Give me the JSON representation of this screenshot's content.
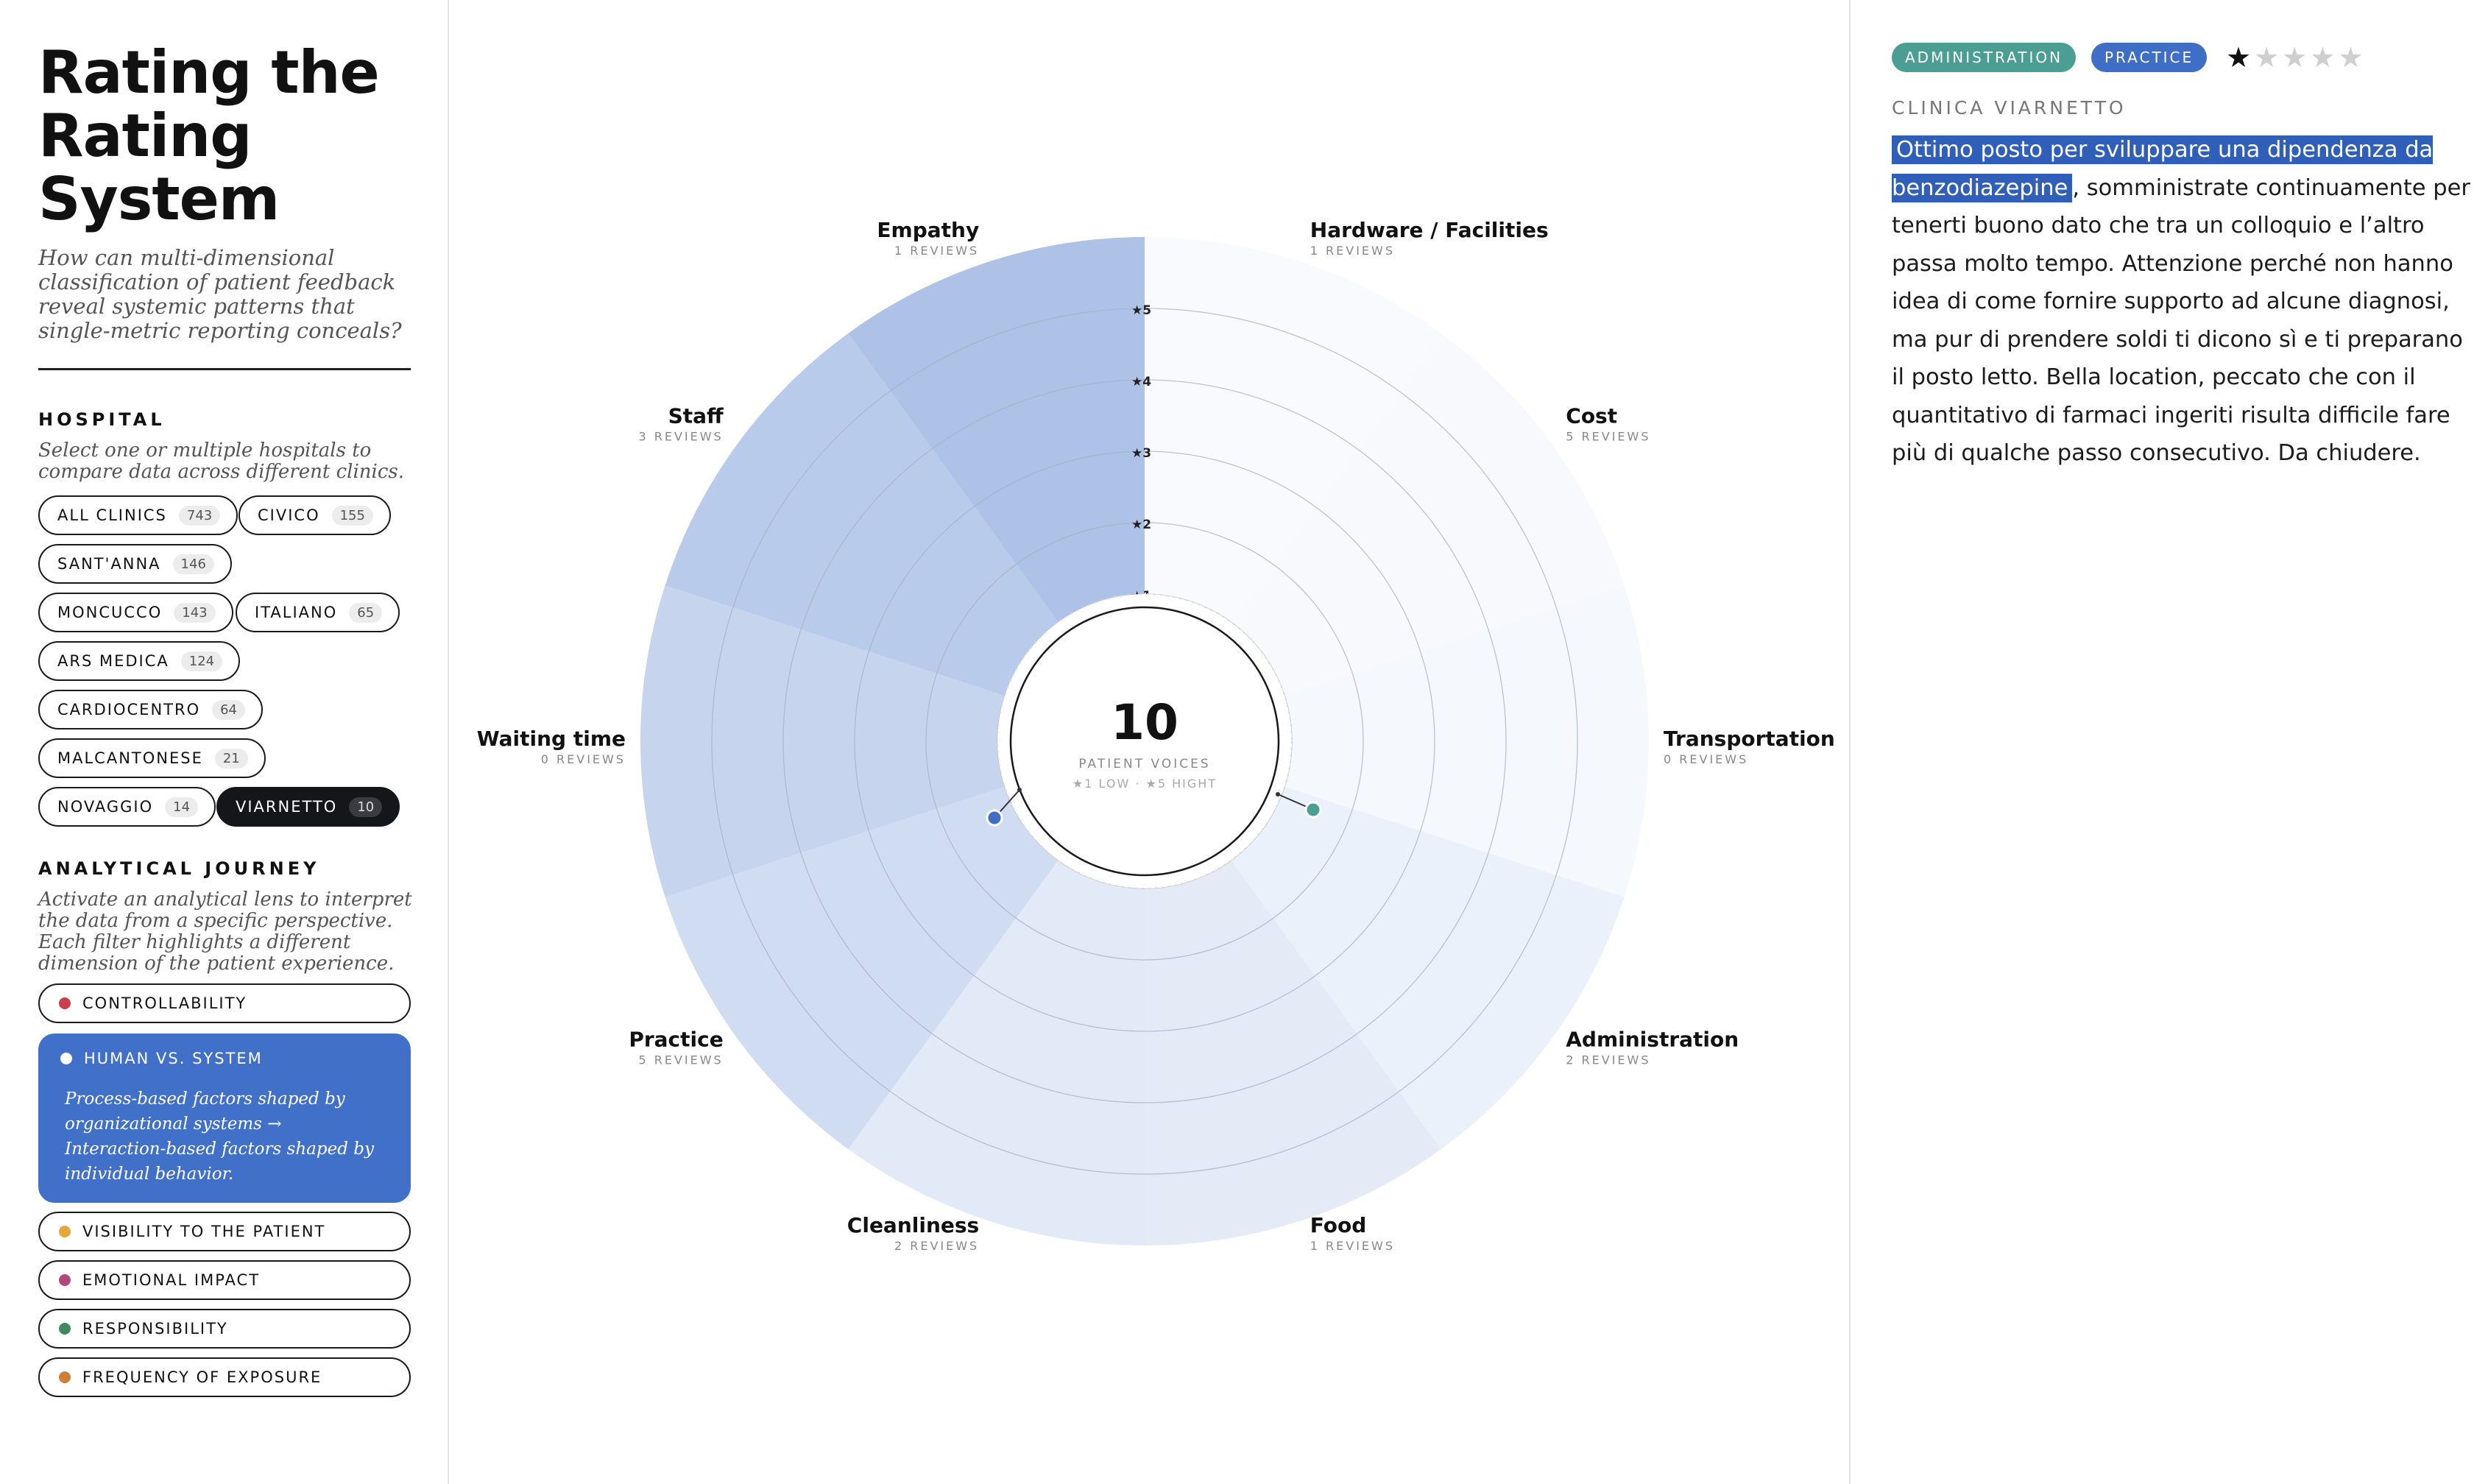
{
  "sidebar": {
    "title": "Rating the Rating System",
    "subtitle": "How can multi-dimensional classification of patient feedback reveal systemic patterns that single-metric reporting conceals?",
    "hospital": {
      "heading": "HOSPITAL",
      "description": "Select one or multiple hospitals to compare data across different clinics.",
      "chips": [
        {
          "label": "ALL CLINICS",
          "count": "743",
          "selected": false
        },
        {
          "label": "CIVICO",
          "count": "155",
          "selected": false
        },
        {
          "label": "SANT'ANNA",
          "count": "146",
          "selected": false
        },
        {
          "label": "MONCUCCO",
          "count": "143",
          "selected": false
        },
        {
          "label": "ITALIANO",
          "count": "65",
          "selected": false
        },
        {
          "label": "ARS MEDICA",
          "count": "124",
          "selected": false
        },
        {
          "label": "CARDIOCENTRO",
          "count": "64",
          "selected": false
        },
        {
          "label": "MALCANTONESE",
          "count": "21",
          "selected": false
        },
        {
          "label": "NOVAGGIO",
          "count": "14",
          "selected": false
        },
        {
          "label": "VIARNETTO",
          "count": "10",
          "selected": true
        }
      ]
    },
    "journey": {
      "heading": "ANALYTICAL JOURNEY",
      "description": "Activate an analytical lens to interpret the data from a specific perspective. Each filter highlights a different dimension of the patient experience.",
      "lenses": [
        {
          "label": "CONTROLLABILITY",
          "color": "#c8414b",
          "active": false
        },
        {
          "label": "HUMAN VS. SYSTEM",
          "color": "#ffffff",
          "active": true,
          "description": "Process-based factors shaped by organizational systems → Interaction-based factors shaped by individual behavior."
        },
        {
          "label": "VISIBILITY TO THE PATIENT",
          "color": "#e3a83a",
          "active": false
        },
        {
          "label": "EMOTIONAL IMPACT",
          "color": "#b2477e",
          "active": false
        },
        {
          "label": "RESPONSIBILITY",
          "color": "#3e8a5e",
          "active": false
        },
        {
          "label": "FREQUENCY OF EXPOSURE",
          "color": "#cf7d38",
          "active": false
        }
      ]
    }
  },
  "chart_data": {
    "type": "radial",
    "center": {
      "value": "10",
      "label": "PATIENT VOICES",
      "legend": "★1 LOW · ★5 HIGHT"
    },
    "scale": {
      "min": 0,
      "max": 5,
      "ticks": [
        "★1",
        "★2",
        "★3",
        "★4",
        "★5"
      ]
    },
    "categories": [
      {
        "name": "Hardware / Facilities",
        "reviews": "1 REVIEWS"
      },
      {
        "name": "Cost",
        "reviews": "5 REVIEWS"
      },
      {
        "name": "Transportation",
        "reviews": "0 REVIEWS"
      },
      {
        "name": "Administration",
        "reviews": "2 REVIEWS"
      },
      {
        "name": "Food",
        "reviews": "1 REVIEWS"
      },
      {
        "name": "Cleanliness",
        "reviews": "2 REVIEWS"
      },
      {
        "name": "Practice",
        "reviews": "5 REVIEWS"
      },
      {
        "name": "Waiting time",
        "reviews": "0 REVIEWS"
      },
      {
        "name": "Staff",
        "reviews": "3 REVIEWS"
      },
      {
        "name": "Empathy",
        "reviews": "1 REVIEWS"
      }
    ],
    "sector_colors": [
      "#f9fafd",
      "#f7f9fc",
      "#f5f8fc",
      "#ebf1fa",
      "#e4ebf7",
      "#e3eaf7",
      "#d0dcf1",
      "#c6d4ee",
      "#b9cbeb",
      "#adc2e6"
    ]
  },
  "detail": {
    "tags": [
      {
        "label": "ADMINISTRATION",
        "color": "#4a9e94"
      },
      {
        "label": "PRACTICE",
        "color": "#3e6ec6"
      }
    ],
    "rating": {
      "value": 1,
      "max": 5
    },
    "clinic": "CLINICA VIARNETTO",
    "review_highlight": "Ottimo posto per sviluppare una dipendenza da benzodiazepine",
    "review_rest": ", somministrate continuamente per tenerti buono dato che tra un colloquio e l’altro passa molto tempo. Attenzione perché non hanno idea di come fornire supporto ad alcune diagnosi, ma pur di prendere soldi ti dicono sì e ti preparano il posto letto. Bella location, peccato che con il quantitativo di farmaci ingeriti risulta difficile fare più di qualche passo consecutivo. Da chiudere."
  }
}
